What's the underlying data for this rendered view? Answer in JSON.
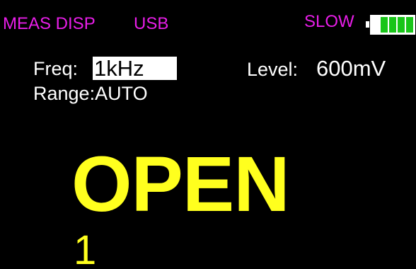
{
  "status_bar": {
    "mode": "MEAS DISP",
    "interface": "USB",
    "speed": "SLOW",
    "battery": {
      "level": 0.8,
      "cells_filled": 4,
      "cells_total": 5,
      "color": "#19c519"
    }
  },
  "settings": {
    "freq_label": "Freq:",
    "freq_value": "1kHz",
    "level_label": "Level:",
    "level_value": "600mV",
    "range_label": "Range:AUTO"
  },
  "reading": {
    "primary": "OPEN",
    "secondary": "1"
  },
  "colors": {
    "background": "#000000",
    "magenta": "#e81ee8",
    "white": "#ffffff",
    "yellow": "#ffff1e",
    "battery_green": "#19c519"
  }
}
